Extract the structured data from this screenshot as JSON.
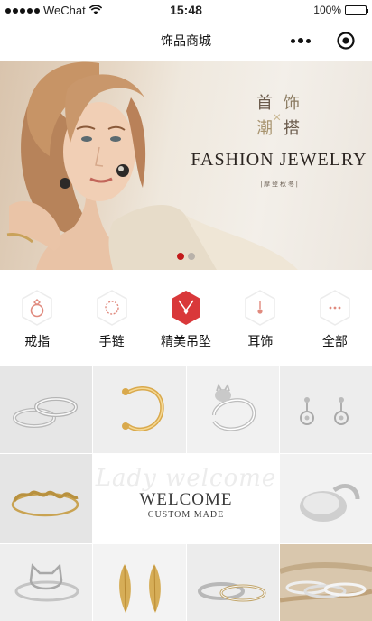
{
  "status_bar": {
    "carrier": "WeChat",
    "time": "15:48",
    "battery": "100%",
    "battery_level": 1.0
  },
  "nav": {
    "title": "饰品商城"
  },
  "banner": {
    "cn_chars": [
      "首",
      "饰",
      "潮",
      "搭"
    ],
    "cn_mark": "×",
    "headline": "FASHION JEWELRY",
    "subline": "| 摩 登 秋 冬 |",
    "slide_count": 2,
    "active_slide": 1
  },
  "categories": [
    {
      "label": "戒指",
      "icon": "ring-icon",
      "active": false
    },
    {
      "label": "手链",
      "icon": "bracelet-icon",
      "active": false
    },
    {
      "label": "精美吊坠",
      "icon": "pendant-icon",
      "active": true
    },
    {
      "label": "耳饰",
      "icon": "earring-icon",
      "active": false
    },
    {
      "label": "全部",
      "icon": "more-dots-icon",
      "active": false
    }
  ],
  "welcome": {
    "script": "Lady welcome",
    "title": "WELCOME",
    "subtitle": "CUSTOM MADE"
  },
  "products": [
    {
      "name": "silver-twin-rings"
    },
    {
      "name": "gold-open-ring"
    },
    {
      "name": "silver-cat-ring"
    },
    {
      "name": "silver-flower-earrings"
    },
    {
      "name": "gold-name-ring"
    },
    {
      "name": "silver-signet-ring"
    },
    {
      "name": "silver-cat-outline-ring"
    },
    {
      "name": "gold-leaf-earrings"
    },
    {
      "name": "silver-stacked-rings"
    },
    {
      "name": "silver-rings-on-wood"
    }
  ],
  "colors": {
    "accent": "#d9383a",
    "icon_line": "#e08a7e",
    "banner_text": "#2b2420"
  }
}
